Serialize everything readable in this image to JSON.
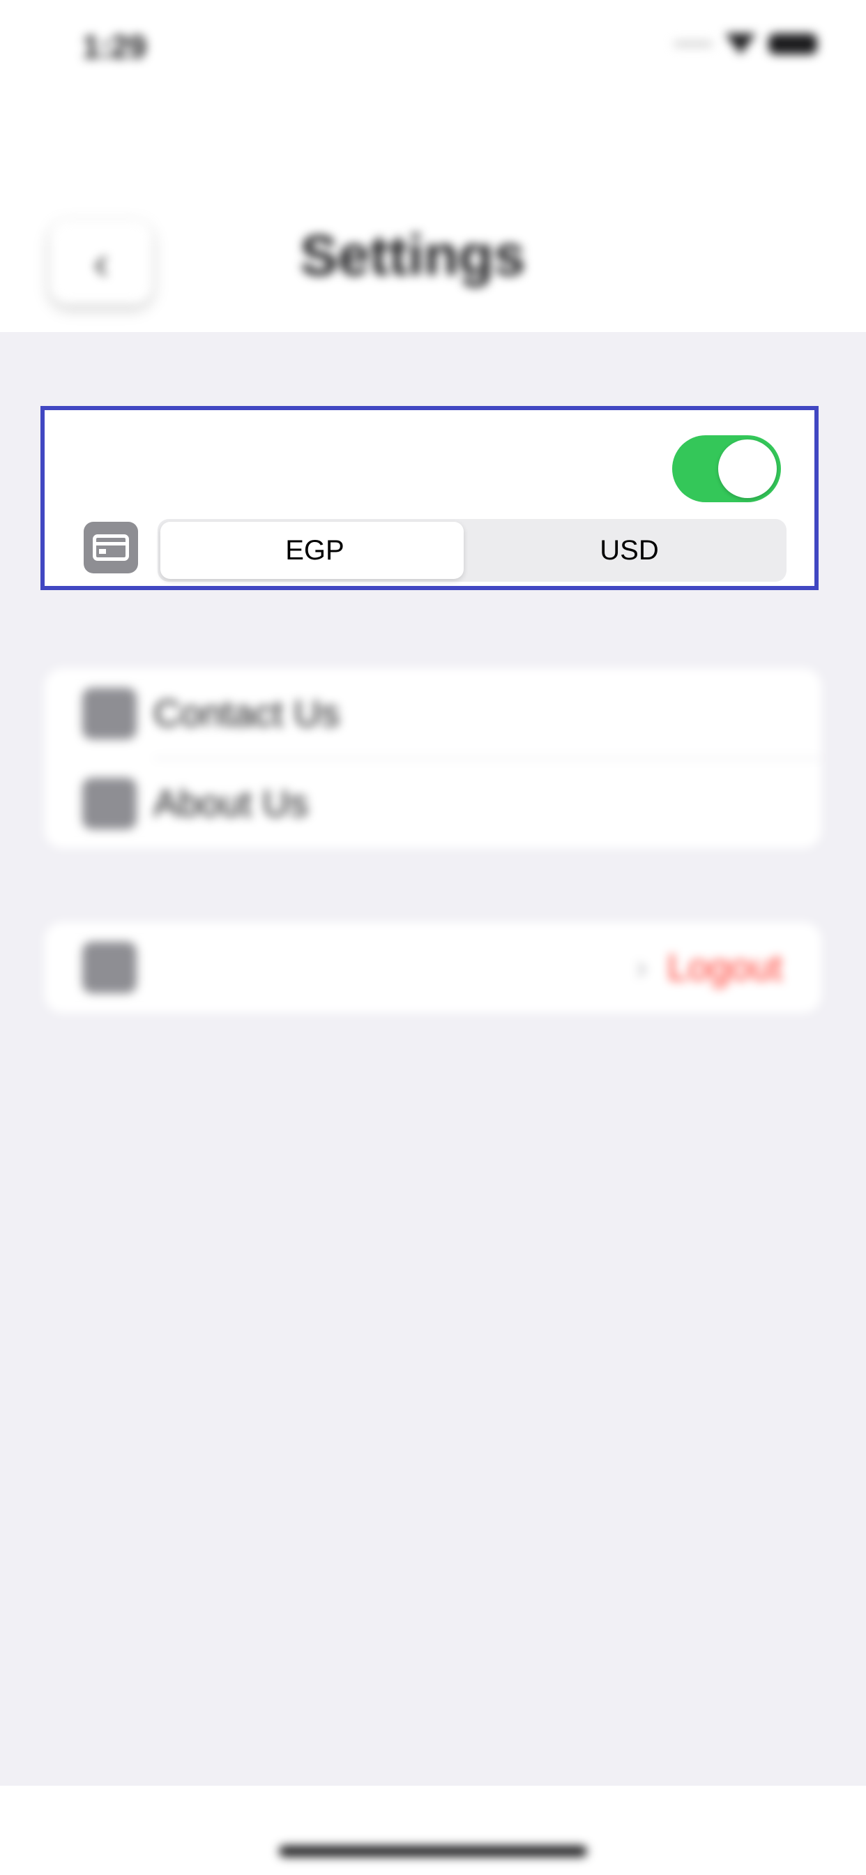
{
  "status_bar": {
    "time": "1:29"
  },
  "header": {
    "back_icon": "chevron-left",
    "title": "Settings"
  },
  "currency": {
    "toggle_on": true,
    "icon": "credit-card-icon",
    "options": [
      "EGP",
      "USD"
    ],
    "selected": "EGP"
  },
  "support": {
    "items": [
      {
        "label": "Contact Us",
        "icon": "phone-icon"
      },
      {
        "label": "About Us",
        "icon": "info-icon"
      }
    ]
  },
  "account": {
    "chevron": "›",
    "logout_label": "Logout",
    "icon": "logout-icon"
  },
  "colors": {
    "accent_border": "#4147c2",
    "toggle_on": "#34c759",
    "logout_text": "#ff3b30",
    "background": "#f1f0f5"
  }
}
